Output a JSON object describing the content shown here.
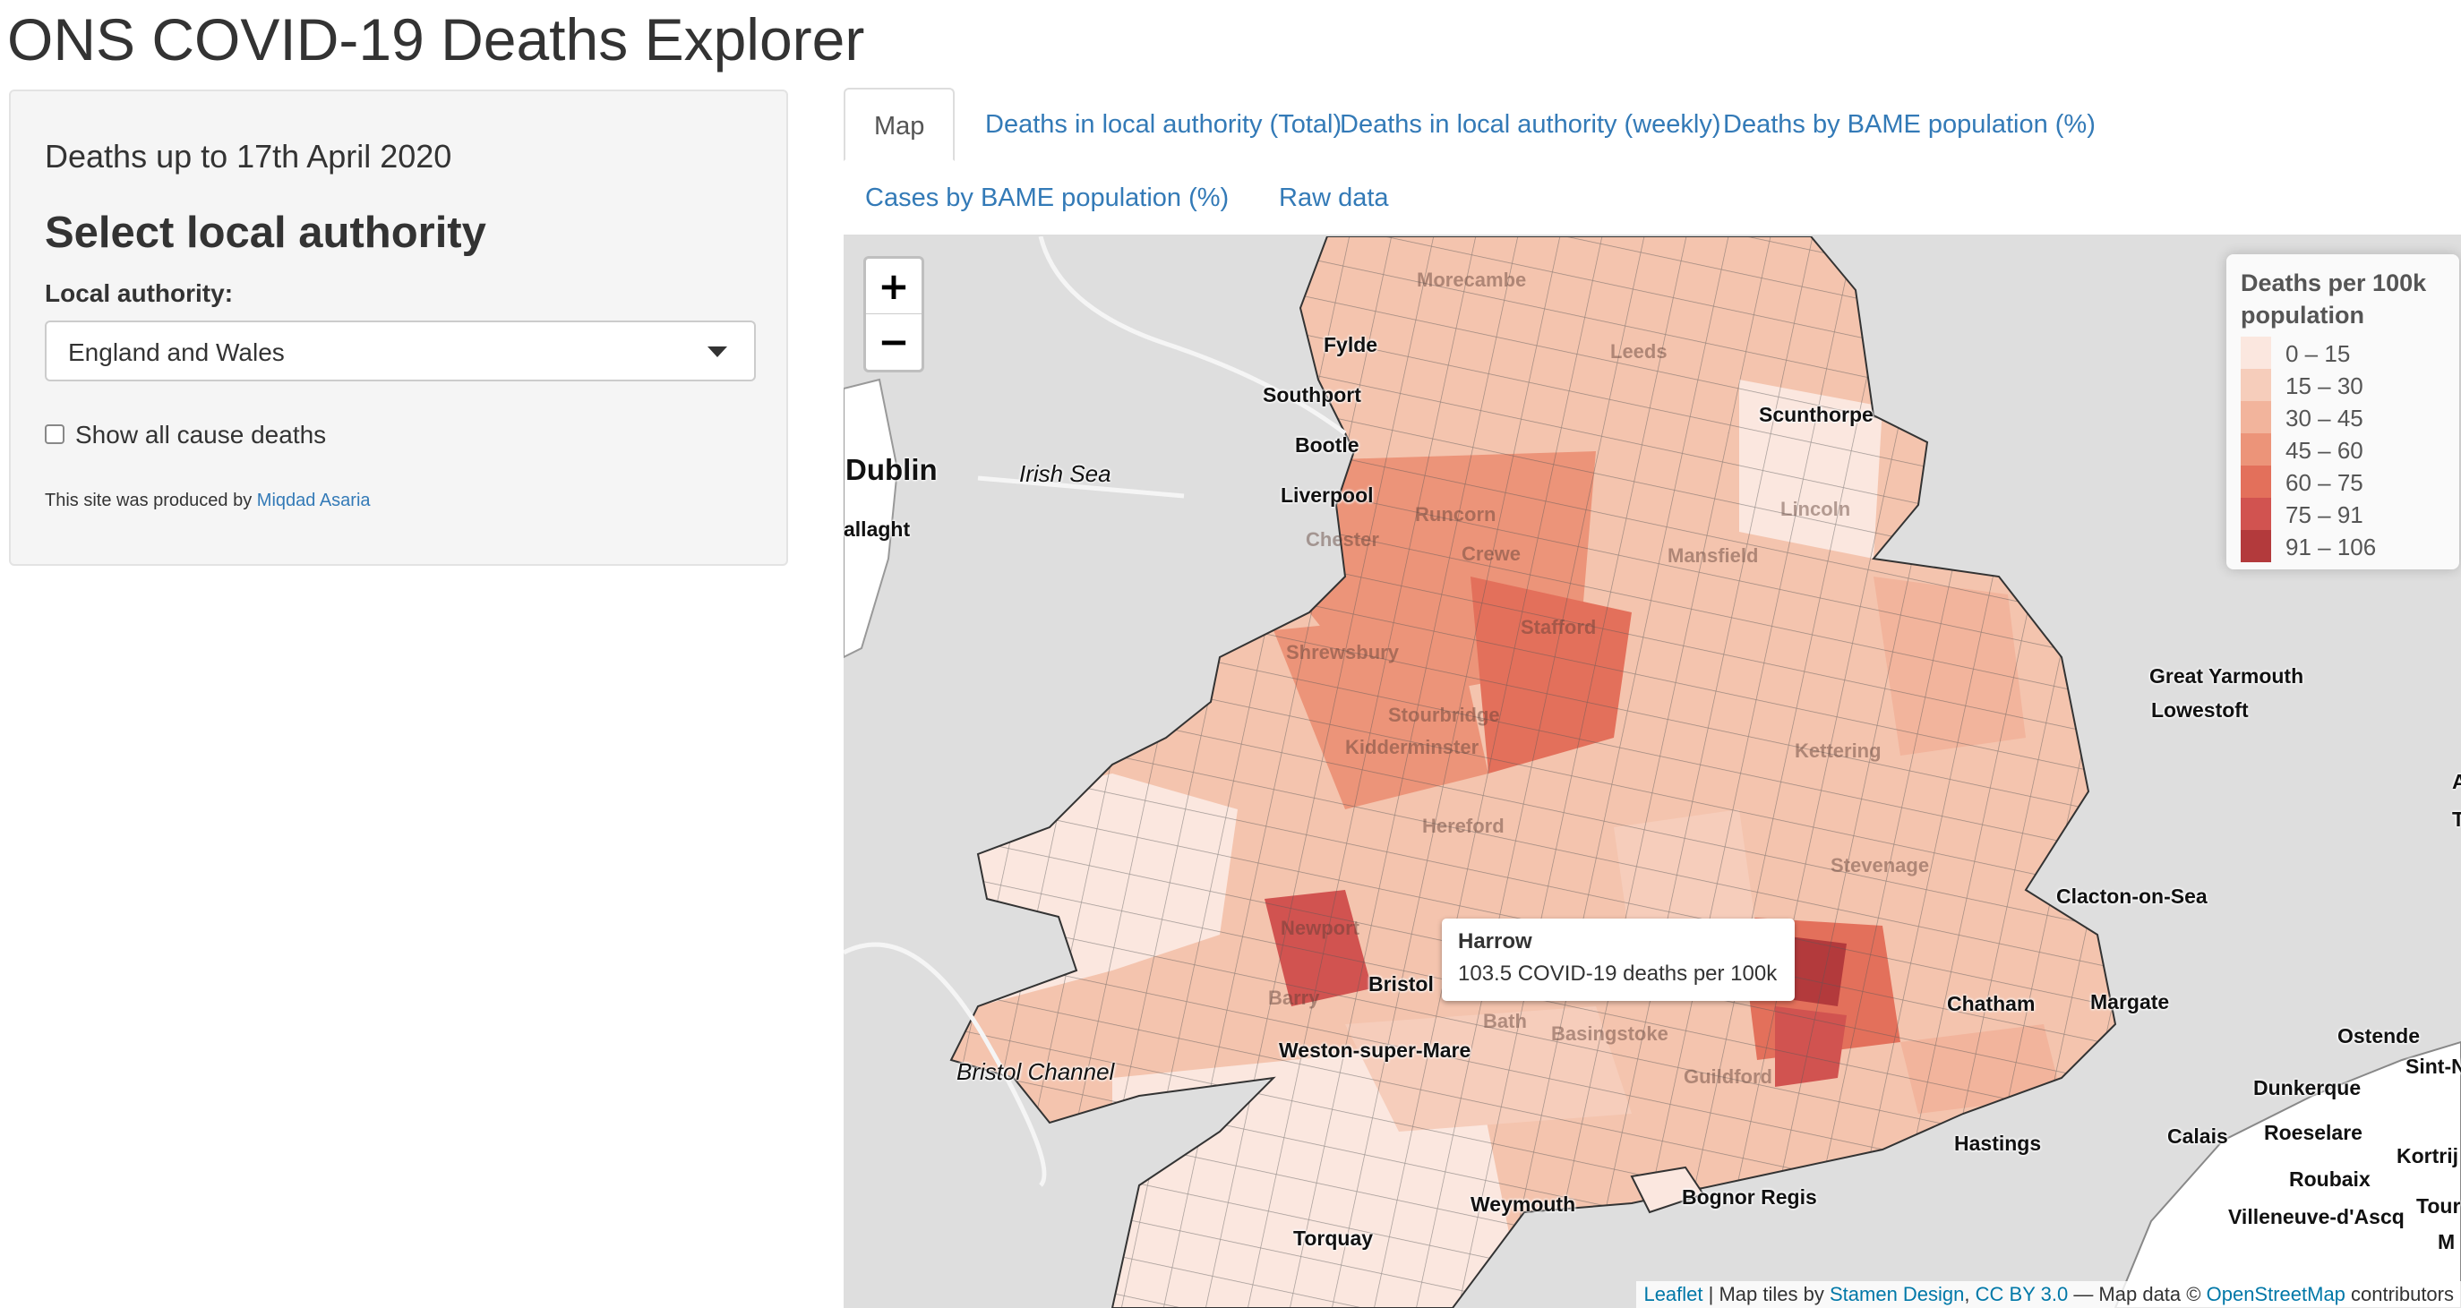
{
  "app": {
    "title": "ONS COVID-19 Deaths Explorer"
  },
  "sidebar": {
    "date_heading": "Deaths up to 17th April 2020",
    "select_heading": "Select local authority",
    "la_label": "Local authority:",
    "la_value": "England and Wales",
    "checkbox_label": "Show all cause deaths",
    "credit_prefix": "This site was produced by",
    "credit_link": "Miqdad Asaria"
  },
  "tabs": [
    {
      "label": "Map",
      "active": true
    },
    {
      "label": "Deaths in local authority (Total)"
    },
    {
      "label": "Deaths in local authority (weekly)"
    },
    {
      "label": "Deaths by BAME population (%)"
    },
    {
      "label": "Cases by BAME population (%)"
    },
    {
      "label": "Raw data"
    }
  ],
  "map": {
    "zoom_in": "+",
    "zoom_out": "−",
    "legend": {
      "title": "Deaths per 100k population",
      "bins": [
        {
          "label": "0 – 15",
          "color": "#fbe7df"
        },
        {
          "label": "15 – 30",
          "color": "#f6cdbb"
        },
        {
          "label": "30 – 45",
          "color": "#f2b49c"
        },
        {
          "label": "45 – 60",
          "color": "#ec9479"
        },
        {
          "label": "60 – 75",
          "color": "#e3705b"
        },
        {
          "label": "75 – 91",
          "color": "#d15350"
        },
        {
          "label": "91 – 106",
          "color": "#b33a3c"
        }
      ]
    },
    "tooltip": {
      "title": "Harrow",
      "text": "103.5 COVID-19 deaths per 100k"
    },
    "attribution": {
      "leaflet": "Leaflet",
      "tiles_prefix": "| Map tiles by",
      "stamen": "Stamen Design",
      "cc": "CC BY 3.0",
      "data_prefix": "— Map data ©",
      "osm": "OpenStreetMap",
      "suffix": "contributors"
    },
    "places": {
      "fylde": "Fylde",
      "southport": "Southport",
      "bootle": "Bootle",
      "dublin": "Dublin",
      "irish_sea": "Irish Sea",
      "allaght": "allaght",
      "liverpool": "Liverpool",
      "great_yarmouth": "Great Yarmouth",
      "lowestoft": "Lowestoft",
      "clacton": "Clacton-on-Sea",
      "margate": "Margate",
      "chatham": "Chatham",
      "bristol": "Bristol",
      "weston": "Weston-super-Mare",
      "bristol_channel": "Bristol Channel",
      "ostende": "Ostende",
      "sint": "Sint-N",
      "dunkerque": "Dunkerque",
      "calais": "Calais",
      "roeselare": "Roeselare",
      "kortrijk": "Kortrij",
      "roubaix": "Roubaix",
      "villeneuve": "Villeneuve-d'Ascq",
      "tour": "Tour",
      "m": "M",
      "torquay": "Torquay",
      "weymouth": "Weymouth",
      "bognor": "Bognor Regis",
      "hastings": "Hastings",
      "scunthorpe": "Scunthorpe",
      "a": "A",
      "t": "T",
      "morecambe": "Morecambe",
      "leeds": "Leeds",
      "lincoln": "Lincoln",
      "runcorn": "Runcorn",
      "chester": "Chester",
      "crewe": "Crewe",
      "mansfield": "Mansfield",
      "shrewsbury": "Shrewsbury",
      "stafford": "Stafford",
      "stourbridge": "Stourbridge",
      "kidderminster": "Kidderminster",
      "hereford": "Hereford",
      "kettering": "Kettering",
      "stevenage": "Stevenage",
      "basingstoke": "Basingstoke",
      "bath": "Bath",
      "guildford": "Guildford",
      "newport": "Newport",
      "barry": "Barry"
    }
  }
}
